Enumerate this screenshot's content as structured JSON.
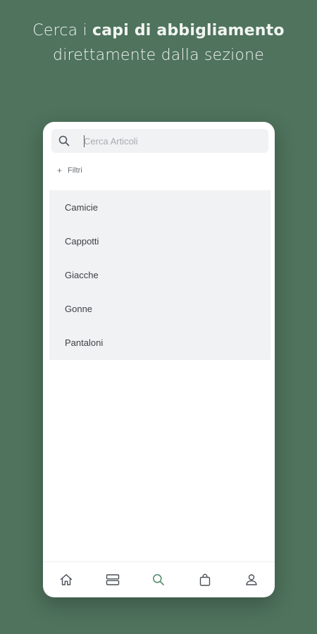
{
  "headline": {
    "line1_prefix": "Cerca i ",
    "line1_bold": "capi di abbigliamento",
    "line2": "direttamente dalla sezione"
  },
  "search": {
    "placeholder": "Cerca Articoli",
    "value": "",
    "icon": "search-icon"
  },
  "filters": {
    "icon": "plus-icon",
    "label": "Filtri"
  },
  "categories": [
    {
      "label": "Camicie"
    },
    {
      "label": "Cappotti"
    },
    {
      "label": "Giacche"
    },
    {
      "label": "Gonne"
    },
    {
      "label": "Pantaloni"
    }
  ],
  "tabbar": {
    "items": [
      {
        "icon": "home-icon",
        "active": false
      },
      {
        "icon": "catalog-icon",
        "active": false
      },
      {
        "icon": "search-icon",
        "active": true
      },
      {
        "icon": "bag-icon",
        "active": false
      },
      {
        "icon": "profile-icon",
        "active": false
      }
    ],
    "active_color": "#4f8a6a",
    "inactive_color": "#4b5058"
  },
  "colors": {
    "background": "#4f735d",
    "card": "#ffffff",
    "list_background": "#f1f2f3"
  }
}
